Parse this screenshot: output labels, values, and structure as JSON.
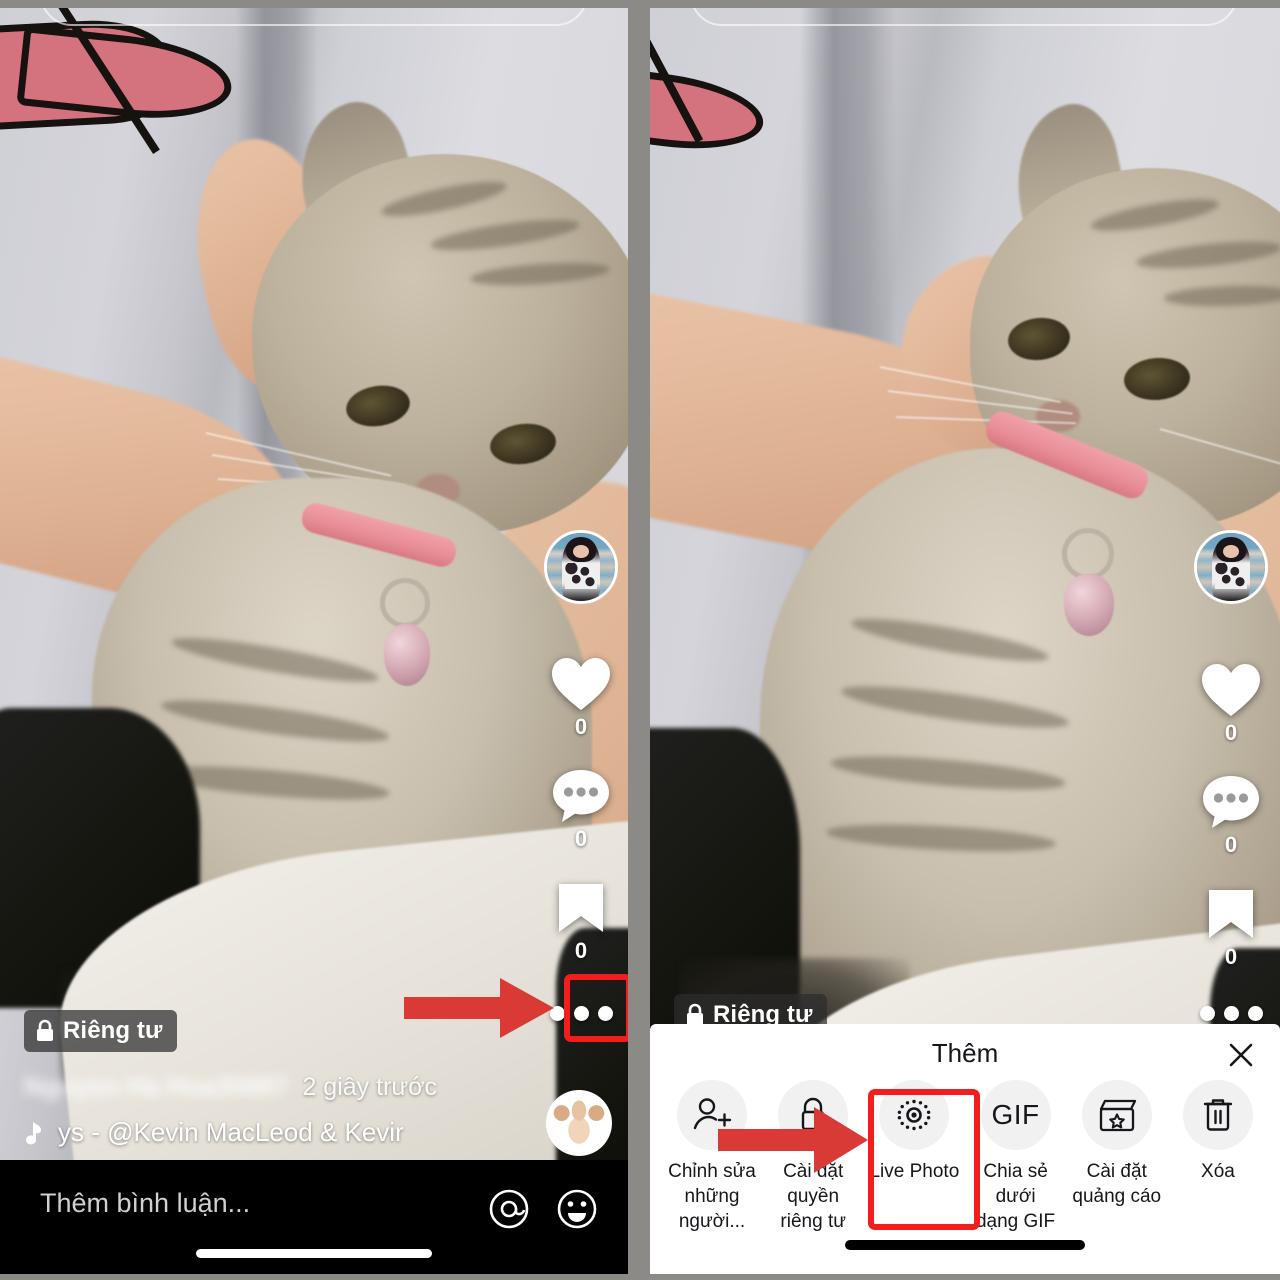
{
  "meta": {
    "accent_red": "#f41d1d",
    "sheet_bg": "#ffffff",
    "sheet_circle_bg": "#f1f1f2",
    "gutter_gray": "#8c8a86"
  },
  "left_panel": {
    "privacy_badge": {
      "label": "Riêng tư",
      "icon": "lock-icon"
    },
    "rail": {
      "avatar": "creator-avatar",
      "like": {
        "icon": "heart-icon",
        "count": "0"
      },
      "comment": {
        "icon": "comment-icon",
        "count": "0"
      },
      "bookmark": {
        "icon": "bookmark-icon",
        "count": "0"
      },
      "more": {
        "icon": "more-dots-icon"
      }
    },
    "caption": {
      "username": "Nguyen Ha Hoa30887",
      "separator": "·",
      "time_ago": "2 giây trước",
      "music_icon": "music-note-icon",
      "music_text": "ys - @Kevin MacLeod & Kevir"
    },
    "comment_bar": {
      "placeholder": "Thêm bình luận...",
      "mention_icon": "at-mention-icon",
      "emoji_icon": "emoji-icon"
    }
  },
  "right_panel": {
    "privacy_badge": {
      "label": "Riêng tư",
      "icon": "lock-icon"
    },
    "rail": {
      "avatar": "creator-avatar",
      "like": {
        "icon": "heart-icon",
        "count": "0"
      },
      "comment": {
        "icon": "comment-icon",
        "count": "0"
      },
      "bookmark": {
        "icon": "bookmark-icon",
        "count": "0"
      },
      "more": {
        "icon": "more-dots-icon"
      }
    },
    "sheet": {
      "title": "Thêm",
      "close_icon": "close-icon",
      "items": [
        {
          "label": "Chỉnh sửa\nnhững người...",
          "icon": "add-person-icon"
        },
        {
          "label": "Cài đặt quyền\nriêng tư",
          "icon": "lock-privacy-icon"
        },
        {
          "label": "Live Photo",
          "icon": "live-photo-icon"
        },
        {
          "label": "Chia sẻ dưới\ndạng GIF",
          "icon": "gif-icon",
          "icon_text": "GIF"
        },
        {
          "label": "Cài đặt\nquảng cáo",
          "icon": "ad-clapperboard-icon"
        },
        {
          "label": "Xóa",
          "icon": "trash-icon"
        }
      ]
    }
  },
  "annotations": {
    "left_arrow": {
      "name": "red-arrow-to-more-button",
      "color": "#d93a36"
    },
    "left_box": {
      "name": "red-highlight-more-button",
      "color": "#f41d1d"
    },
    "sheet_arrow": {
      "name": "red-arrow-to-live-photo",
      "color": "#d93a36"
    },
    "sheet_box": {
      "name": "red-highlight-live-photo",
      "color": "#f41d1d"
    }
  }
}
